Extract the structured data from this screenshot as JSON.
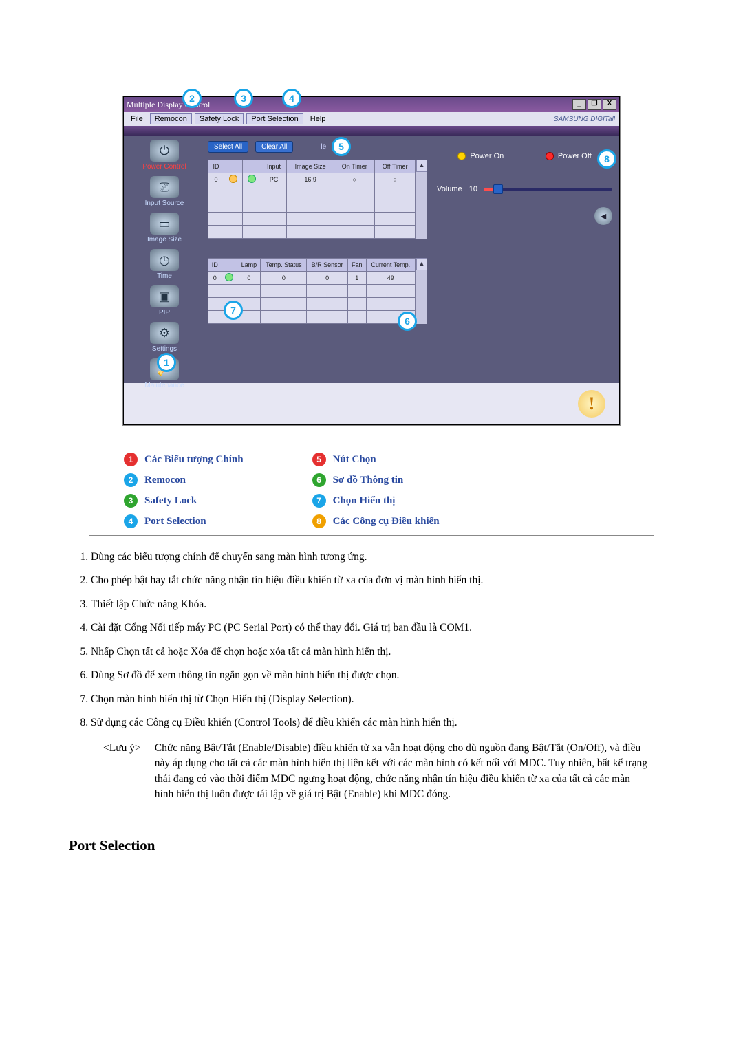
{
  "window": {
    "title": "Multiple Display Control",
    "brand": "SAMSUNG DIGITall",
    "menubar": {
      "file": "File",
      "remocon": "Remocon",
      "safety_lock": "Safety Lock",
      "port_selection": "Port Selection",
      "help": "Help"
    },
    "caption_buttons": {
      "min": "_",
      "restore": "❐",
      "close": "X"
    }
  },
  "sidebar": [
    {
      "label": "Power Control",
      "icon": "⏻",
      "active": true
    },
    {
      "label": "Input Source",
      "icon": "⎚"
    },
    {
      "label": "Image Size",
      "icon": "▭"
    },
    {
      "label": "Time",
      "icon": "◷"
    },
    {
      "label": "PIP",
      "icon": "▣"
    },
    {
      "label": "Settings",
      "icon": "⚙"
    },
    {
      "label": "Maintenance",
      "icon": "🧹"
    }
  ],
  "toolbar": {
    "select_all": "Select All",
    "clear_all": "Clear All",
    "mid_label": "le"
  },
  "table_top": {
    "headers": [
      "ID",
      "",
      "",
      "Input",
      "Image Size",
      "On Timer",
      "Off Timer"
    ],
    "row": {
      "id": "0",
      "input": "PC",
      "image_size": "16:9",
      "on_timer": "○",
      "off_timer": "○"
    }
  },
  "table_bottom": {
    "headers": [
      "ID",
      "",
      "Lamp",
      "Temp. Status",
      "B/R Sensor",
      "Fan",
      "Current Temp."
    ],
    "row": {
      "id": "0",
      "lamp": "0",
      "temp_status": "0",
      "br_sensor": "0",
      "fan": "1",
      "current_temp": "49"
    }
  },
  "right_panel": {
    "power_on": "Power On",
    "power_off": "Power Off",
    "volume_label": "Volume",
    "volume_value": "10"
  },
  "callouts": {
    "c1": "1",
    "c2": "2",
    "c3": "3",
    "c4": "4",
    "c5": "5",
    "c6": "6",
    "c7": "7",
    "c8": "8"
  },
  "legend": {
    "left": [
      {
        "num": "1",
        "color": "red",
        "text": "Các Biểu tượng Chính"
      },
      {
        "num": "2",
        "color": "blue",
        "text": "Remocon"
      },
      {
        "num": "3",
        "color": "green",
        "text": "Safety Lock"
      },
      {
        "num": "4",
        "color": "blue",
        "text": "Port Selection"
      }
    ],
    "right": [
      {
        "num": "5",
        "color": "red",
        "text": "Nút Chọn"
      },
      {
        "num": "6",
        "color": "green",
        "text": "Sơ đồ Thông tin"
      },
      {
        "num": "7",
        "color": "blue",
        "text": "Chọn Hiển thị"
      },
      {
        "num": "8",
        "color": "orange",
        "text": "Các Công cụ Điều khiển"
      }
    ]
  },
  "list": [
    "Dùng các biểu tượng chính để chuyển sang màn hình tương ứng.",
    "Cho phép bật hay tắt chức năng nhận tín hiệu điều khiển từ xa của đơn vị màn hình hiển thị.",
    "Thiết lập Chức năng Khóa.",
    "Cài đặt Cổng Nối tiếp máy PC (PC Serial Port) có thể thay đổi. Giá trị ban đầu là COM1.",
    "Nhấp Chọn tất cả hoặc Xóa để chọn hoặc xóa tất cả màn hình hiển thị.",
    "Dùng Sơ đồ để xem thông tin ngắn gọn về màn hình hiển thị được chọn.",
    "Chọn màn hình hiển thị từ Chọn Hiển thị (Display Selection).",
    "Sử dụng các Công cụ Điều khiển (Control Tools) để điều khiển các màn hình hiển thị."
  ],
  "note": {
    "label": "<Lưu ý>",
    "body": "Chức năng Bật/Tắt (Enable/Disable) điều khiển từ xa vẫn hoạt động cho dù nguồn đang Bật/Tắt (On/Off), và điều này áp dụng cho tất cả các màn hình hiển thị liên kết với các màn hình có kết nối với MDC. Tuy nhiên, bất kể trạng thái đang có vào thời điểm MDC ngưng hoạt động, chức năng nhận tín hiệu điều khiển từ xa của tất cả các màn hình hiển thị luôn được tái lập về giá trị Bật (Enable) khi MDC đóng."
  },
  "section_heading": "Port Selection"
}
